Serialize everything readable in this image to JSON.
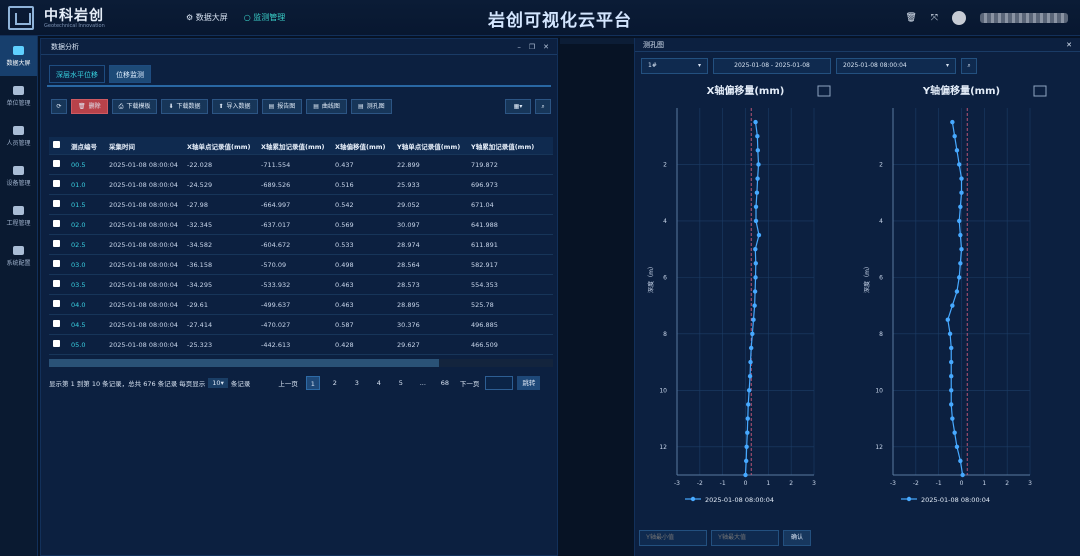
{
  "app": {
    "brand": "中科岩创",
    "brand_sub": "Geotechnical Innovation",
    "title": "岩创可视化云平台",
    "nav": [
      "数据大屏",
      "监测管理"
    ]
  },
  "sidebar": [
    {
      "label": "数据大屏",
      "icon": "cube-icon"
    },
    {
      "label": "单位管理",
      "icon": "calendar-icon"
    },
    {
      "label": "人员管理",
      "icon": "id-card-icon"
    },
    {
      "label": "设备管理",
      "icon": "gear-icon"
    },
    {
      "label": "工程管理",
      "icon": "chart-icon"
    },
    {
      "label": "系统配置",
      "icon": "more-icon"
    }
  ],
  "panel": {
    "title": "数据分析",
    "tabs": [
      "深层水平位移",
      "位移监测"
    ]
  },
  "toolbar": {
    "delete": "删除",
    "download_template": "下载模板",
    "download_data": "下载数据",
    "import_data": "导入数据",
    "report": "报告图",
    "curve": "曲线图",
    "hole": "测孔图"
  },
  "table": {
    "headers": [
      "测点编号",
      "采集时间",
      "X轴单点记录值(mm)",
      "X轴累加记录值(mm)",
      "X轴偏移值(mm)",
      "Y轴单点记录值(mm)",
      "Y轴累加记录值(mm)"
    ],
    "rows": [
      [
        "00.5",
        "2025-01-08 08:00:04",
        "-22.028",
        "-711.554",
        "0.437",
        "22.899",
        "719.872"
      ],
      [
        "01.0",
        "2025-01-08 08:00:04",
        "-24.529",
        "-689.526",
        "0.516",
        "25.933",
        "696.973"
      ],
      [
        "01.5",
        "2025-01-08 08:00:04",
        "-27.98",
        "-664.997",
        "0.542",
        "29.052",
        "671.04"
      ],
      [
        "02.0",
        "2025-01-08 08:00:04",
        "-32.345",
        "-637.017",
        "0.569",
        "30.097",
        "641.988"
      ],
      [
        "02.5",
        "2025-01-08 08:00:04",
        "-34.582",
        "-604.672",
        "0.533",
        "28.974",
        "611.891"
      ],
      [
        "03.0",
        "2025-01-08 08:00:04",
        "-36.158",
        "-570.09",
        "0.498",
        "28.564",
        "582.917"
      ],
      [
        "03.5",
        "2025-01-08 08:00:04",
        "-34.295",
        "-533.932",
        "0.463",
        "28.573",
        "554.353"
      ],
      [
        "04.0",
        "2025-01-08 08:00:04",
        "-29.61",
        "-499.637",
        "0.463",
        "28.895",
        "525.78"
      ],
      [
        "04.5",
        "2025-01-08 08:00:04",
        "-27.414",
        "-470.027",
        "0.587",
        "30.376",
        "496.885"
      ],
      [
        "05.0",
        "2025-01-08 08:00:04",
        "-25.323",
        "-442.613",
        "0.428",
        "29.627",
        "466.509"
      ]
    ]
  },
  "pager": {
    "summary": "显示第 1 到第 10 条记录，总共 676 条记录 每页显示",
    "per_page": "10",
    "per_page_suffix": "条记录",
    "prev": "上一页",
    "next": "下一页",
    "pages": [
      "1",
      "2",
      "3",
      "4",
      "5",
      "...",
      "68"
    ],
    "jump": "跳转"
  },
  "right": {
    "title": "测孔图",
    "hole": "1#",
    "date_range": "2025-01-08 - 2025-01-08",
    "time": "2025-01-08 08:00:04",
    "y_min_ph": "Y轴最小值",
    "y_max_ph": "Y轴最大值",
    "confirm": "确认"
  },
  "chart_data": [
    {
      "type": "line",
      "title": "X轴偏移量(mm)",
      "ylabel": "深度（m）",
      "xlim": [
        -3,
        3
      ],
      "ylim": [
        13,
        0
      ],
      "xticks": [
        -3,
        -2,
        -1,
        0,
        1,
        2,
        3
      ],
      "yticks": [
        2,
        4,
        6,
        8,
        10,
        12
      ],
      "legend": "2025-01-08 08:00:04",
      "legend_position": "bottom",
      "series": [
        {
          "name": "2025-01-08 08:00:04",
          "x": [
            0.44,
            0.52,
            0.54,
            0.57,
            0.53,
            0.5,
            0.46,
            0.46,
            0.59,
            0.43,
            0.45,
            0.44,
            0.42,
            0.4,
            0.35,
            0.3,
            0.25,
            0.22,
            0.2,
            0.16,
            0.12,
            0.1,
            0.08,
            0.05,
            0.03,
            0.0
          ],
          "y": [
            0.5,
            1,
            1.5,
            2,
            2.5,
            3,
            3.5,
            4,
            4.5,
            5,
            5.5,
            6,
            6.5,
            7,
            7.5,
            8,
            8.5,
            9,
            9.5,
            10,
            10.5,
            11,
            11.5,
            12,
            12.5,
            13
          ]
        }
      ]
    },
    {
      "type": "line",
      "title": "Y轴偏移量(mm)",
      "ylabel": "深度（m）",
      "xlim": [
        -3,
        3
      ],
      "ylim": [
        13,
        0
      ],
      "xticks": [
        -3,
        -2,
        -1,
        0,
        1,
        2,
        3
      ],
      "yticks": [
        2,
        4,
        6,
        8,
        10,
        12
      ],
      "legend": "2025-01-08 08:00:04",
      "legend_position": "bottom",
      "series": [
        {
          "name": "2025-01-08 08:00:04",
          "x": [
            -0.4,
            -0.3,
            -0.2,
            -0.1,
            0.0,
            0.0,
            -0.05,
            -0.1,
            -0.05,
            0.0,
            -0.05,
            -0.1,
            -0.2,
            -0.4,
            -0.6,
            -0.5,
            -0.45,
            -0.45,
            -0.45,
            -0.45,
            -0.45,
            -0.4,
            -0.3,
            -0.2,
            -0.05,
            0.05
          ],
          "y": [
            0.5,
            1,
            1.5,
            2,
            2.5,
            3,
            3.5,
            4,
            4.5,
            5,
            5.5,
            6,
            6.5,
            7,
            7.5,
            8,
            8.5,
            9,
            9.5,
            10,
            10.5,
            11,
            11.5,
            12,
            12.5,
            13
          ]
        }
      ]
    }
  ]
}
